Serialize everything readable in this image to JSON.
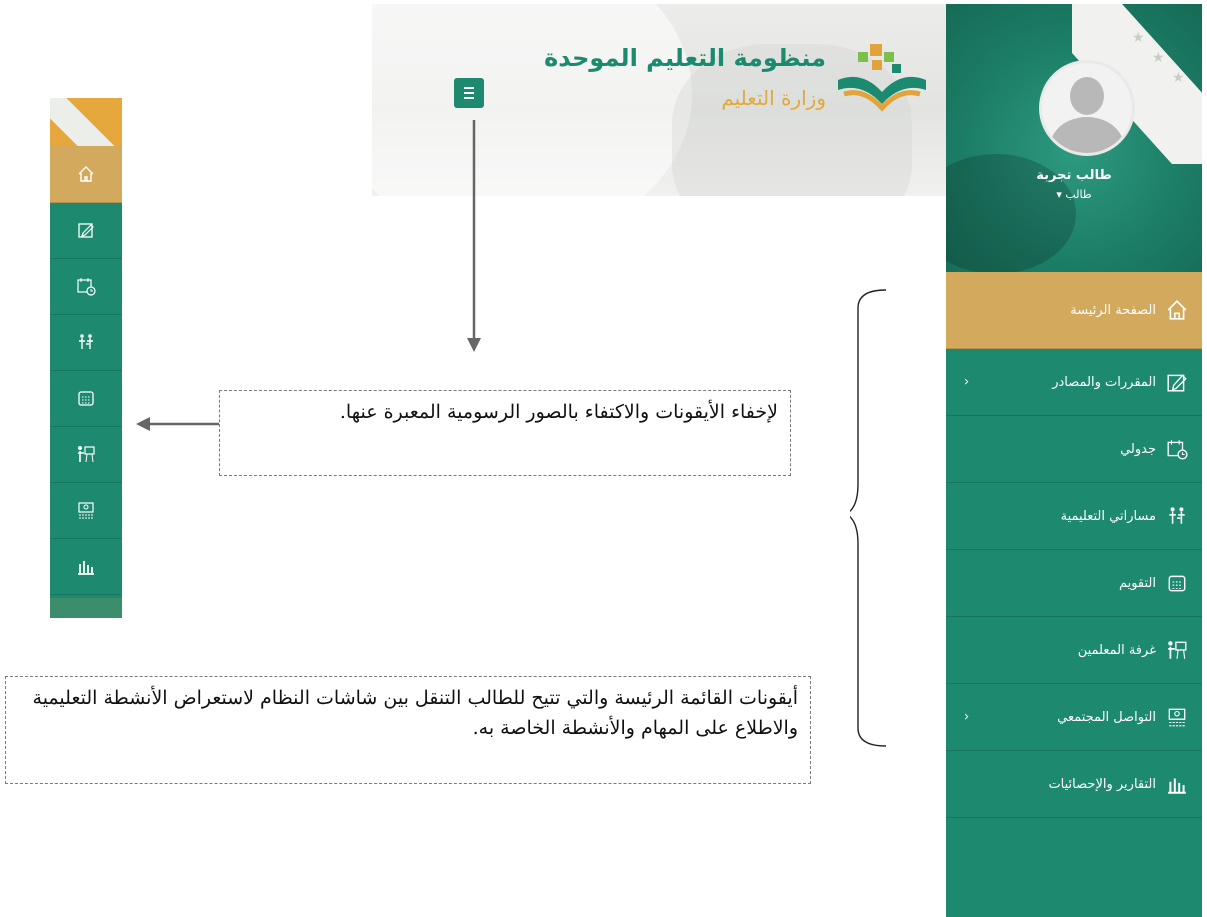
{
  "header": {
    "title": "منظومة التعليم الموحدة",
    "subtitle": "وزارة التعليم",
    "menu_icon": "hamburger-icon"
  },
  "sidebar": {
    "user": {
      "name": "طالب تجربة",
      "role": "طالب ▾"
    },
    "items": [
      {
        "label": "الصفحة الرئيسة",
        "icon": "home-icon",
        "active": true,
        "submenu": false
      },
      {
        "label": "المقررات والمصادر",
        "icon": "edit-icon",
        "active": false,
        "submenu": true
      },
      {
        "label": "جدولي",
        "icon": "calendar-clock-icon",
        "active": false,
        "submenu": false
      },
      {
        "label": "مساراتي التعليمية",
        "icon": "learning-path-icon",
        "active": false,
        "submenu": false
      },
      {
        "label": "التقويم",
        "icon": "calendar-icon",
        "active": false,
        "submenu": false
      },
      {
        "label": "غرفة المعلمين",
        "icon": "teacher-board-icon",
        "active": false,
        "submenu": false
      },
      {
        "label": "التواصل المجتمعي",
        "icon": "community-icon",
        "active": false,
        "submenu": true
      },
      {
        "label": "التقارير والإحصائيات",
        "icon": "bar-chart-icon",
        "active": false,
        "submenu": false
      }
    ],
    "chevron": "‹"
  },
  "annotations": {
    "hide_icons": "لإخفاء الأيقونات والاكتفاء بالصور الرسومية المعبرة عنها.",
    "main_icons": "أيقونات القائمة الرئيسة والتي تتيح للطالب التنقل بين شاشات النظام لاستعراض الأنشطة التعليمية والاطلاع على المهام والأنشطة الخاصة به."
  },
  "colors": {
    "primary": "#1d8a70",
    "active": "#d3a95e",
    "accent": "#e0a93b"
  }
}
